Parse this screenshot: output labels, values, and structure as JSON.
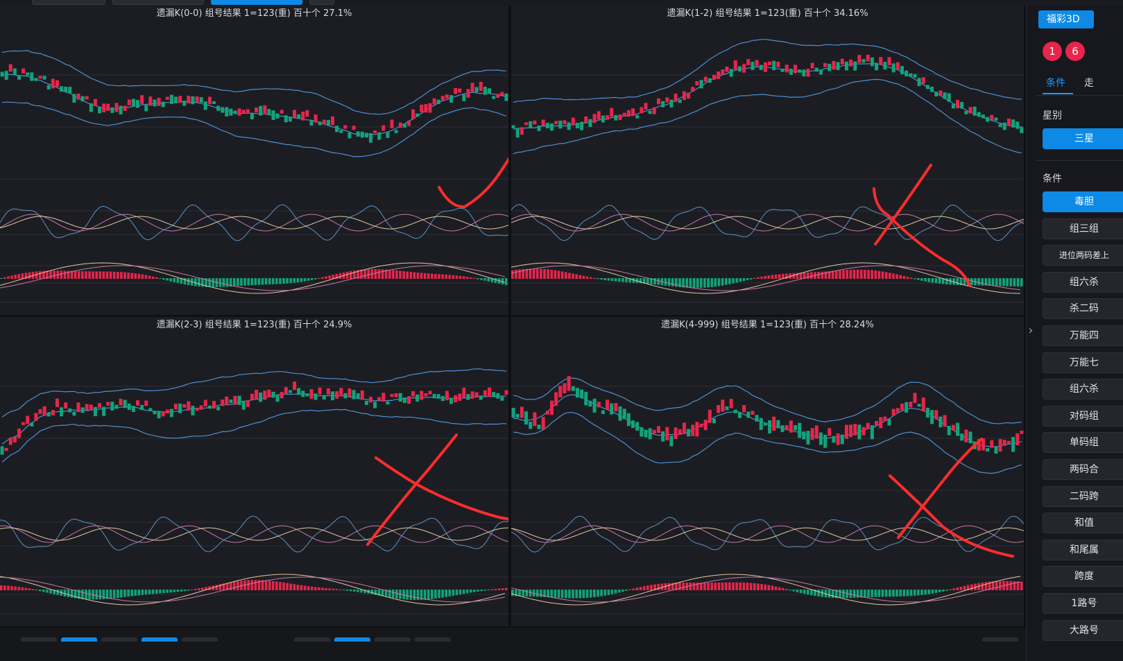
{
  "panels": [
    {
      "title": "遗漏K(0-0)  组号结果  1=123(重)  百十个  27.1%"
    },
    {
      "title": "遗漏K(1-2)  组号结果  1=123(重)  百十个  34.16%"
    },
    {
      "title": "遗漏K(2-3)  组号结果  1=123(重)  百十个  24.9%"
    },
    {
      "title": "遗漏K(4-999)  组号结果  1=123(重)  百十个  28.24%"
    }
  ],
  "sidebar": {
    "lottery_tag": "福彩3D",
    "balls": [
      "1",
      "6"
    ],
    "tabs": [
      "条件",
      "走"
    ],
    "section_star": "星别",
    "star_button": "三星",
    "section_conditions": "条件",
    "conditions": [
      "毒胆",
      "组三组",
      "进位两码差上",
      "组六杀",
      "杀二码",
      "万能四",
      "万能七",
      "组六杀",
      "对码组",
      "单码组",
      "两码合",
      "二码跨",
      "和值",
      "和尾属",
      "跨度",
      "1路号",
      "大路号"
    ]
  },
  "colors": {
    "panel_bg": "#1c1d22",
    "up": "#e8254b",
    "down": "#12a37a",
    "band": "#4d8fd6",
    "accent": "#0d8ae6",
    "annotation": "#ff2d2d"
  }
}
